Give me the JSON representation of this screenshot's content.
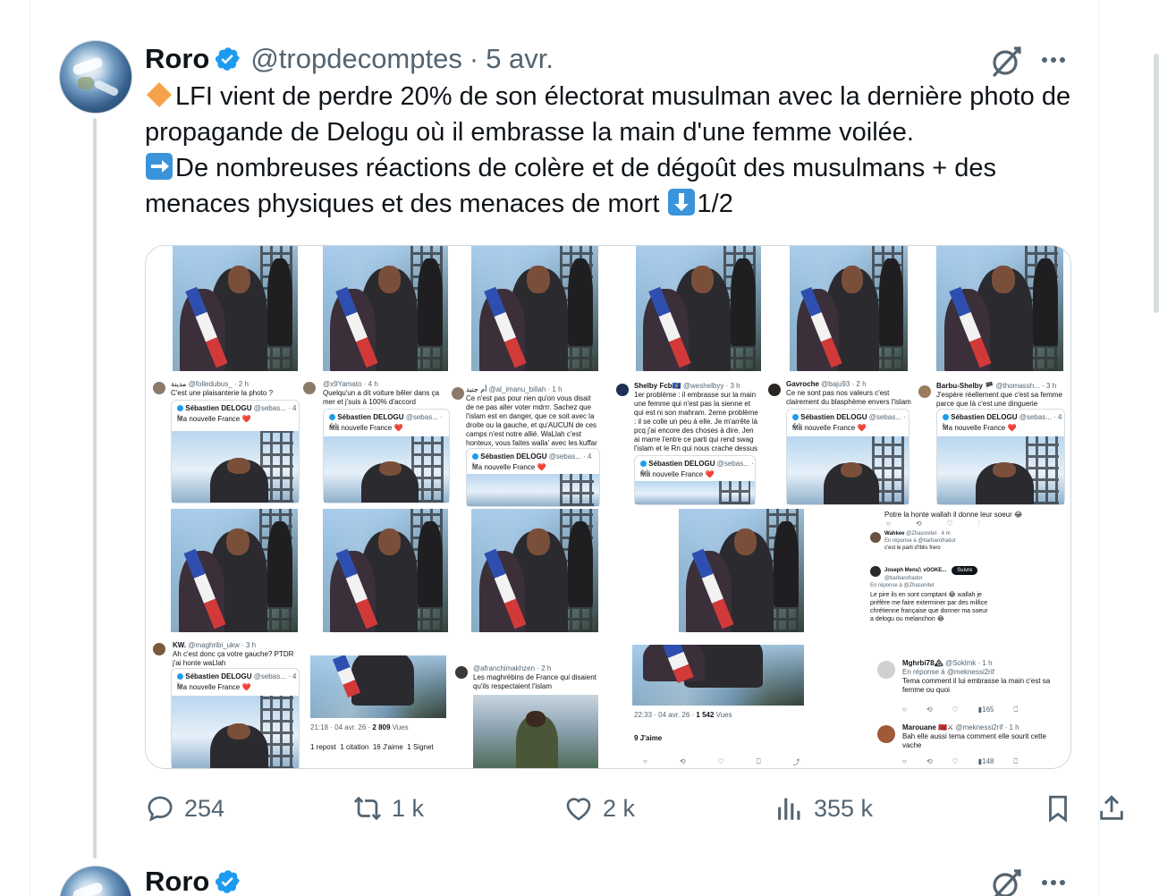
{
  "tweet": {
    "author_name": "Roro",
    "handle": "@tropdecomptes",
    "separator": "·",
    "date": "5 avr.",
    "text_line1": "LFI vient de perdre 20% de son électorat musulman avec la dernière photo de propagande de Delogu où il embrasse la main d'une femme voilée.",
    "text_line2": "De nombreuses réactions de colère et de dégoût des musulmans + des menaces physiques et des menaces de mort ",
    "text_line2_suffix": "1/2",
    "emoji_1": "diamond-orange-icon",
    "emoji_2": "arrow-right-icon",
    "emoji_3": "arrow-down-icon",
    "stats": {
      "replies": "254",
      "reposts": "1 k",
      "likes": "2 k",
      "views": "355 k"
    }
  },
  "collage": {
    "posts": [
      {
        "name": "مدينة",
        "handle": "@folledubus_ · 2 h",
        "text": "C'est une plaisanterie la photo ?"
      },
      {
        "name": "",
        "handle": "@x9Yamato · 4 h",
        "text": "Quelqu'un a dit voiture bêler dans ça mer et j'suis à 100% d'accord"
      },
      {
        "name": "أم جنيد",
        "handle": "@al_imanu_billah · 1 h",
        "text": "Ce n'est pas pour rien qu'on vous disait de ne pas aller voter mdrrr. Sachez que l'islam est en danger, que ce soit avec la droite ou la gauche, et qu'AUCUN de ces camps n'est notre allié. WaLlah c'est honteux, vous faites walla' avec les kuffar et bara' avec les musulmans 😂😂"
      },
      {
        "name": "Shelby Fcb🇽🇰",
        "handle": "@weshelbyy · 3 h",
        "text": "1er problème : il embrasse sur la main une femme qui n'est pas la sienne et qui est ni son mahram. 2eme problème : il se colle un peu à elle. Je m'arrête là pcq j'ai encore des choses à dire. Jen ai marre l'entre ce parti qui rend swag l'islam et le Rn qui nous crache dessus"
      },
      {
        "name": "Gavroche",
        "handle": "@baju93 · 2 h",
        "text": "Ce ne sont pas nos valeurs c'est clairement du blasphème envers l'islam"
      },
      {
        "name": "Barbu-Shelby 🏴",
        "handle": "@thomassh... · 3 h",
        "text": "J'espère réellement que c'est sa femme parce que là c'est une dinguerie"
      },
      {
        "name": "KW.",
        "handle": "@maghribi_ukw · 3 h",
        "text": "Ah c'est donc ça votre gauche? PTDR j'ai honte waLlah"
      },
      {
        "name": "",
        "handle": "@afranchimakhzen · 2 h",
        "text": "Les maghrébins de France qui disaient qu'ils respectaient l'islam"
      }
    ],
    "quote_author": "Sébastien DELOGU",
    "quote_handle": "@sebas... · 4 h",
    "quote_text": "Ma nouvelle France ❤️",
    "thread_b": {
      "line1": "Potre la honte wallah il donne leur soeur 😂",
      "reply1_name": "Wahkee",
      "reply1_handle": "@Zhasonitet · 4 m",
      "reply1_inreply": "En réponse à @barbarofrador",
      "reply1_text": "c'est le parti d'Iblis frero",
      "reply2_name": "Joseph Mensᚢ vOOKE...",
      "reply2_handle": "@barbarofrador",
      "follow_label": "Suivre",
      "reply2_inreply": "En réponse à @Zhasonitet",
      "reply2_text": "Le pire ils en sont comptant 😂 wallah je préfère me faire exterminer par des millice chrétienne française que donner ma soeur a delogu ou melanchon 😂"
    },
    "stats_a": {
      "time": "21:18 · 04 avr. 26 ·",
      "views": "2 809",
      "views_label": "Vues",
      "reposts": "1 repost",
      "quotes": "1 citation",
      "likes": "16 J'aime",
      "bookmarks": "1 Signet"
    },
    "stats_b": {
      "time": "22:33 · 04 avr. 26 ·",
      "views": "1 542",
      "views_label": "Vues",
      "likes": "9 J'aime"
    },
    "thread_c": {
      "r1_name": "Mghrbi78🏔",
      "r1_handle": "@Soklmk · 1 h",
      "r1_inreply": "En réponse à @meknessi2rif",
      "r1_text": "Tema comment il lui embrasse la main c'est sa femme ou quoi",
      "r1_views": "165",
      "r2_name": "Marouane 🇲🇦⚔",
      "r2_handle": "@meknessi2rif · 1 h",
      "r2_text": "Bah elle aussi tema comment elle sourit cette vache",
      "r2_views": "148"
    }
  },
  "tweet2": {
    "author_name": "Roro"
  }
}
